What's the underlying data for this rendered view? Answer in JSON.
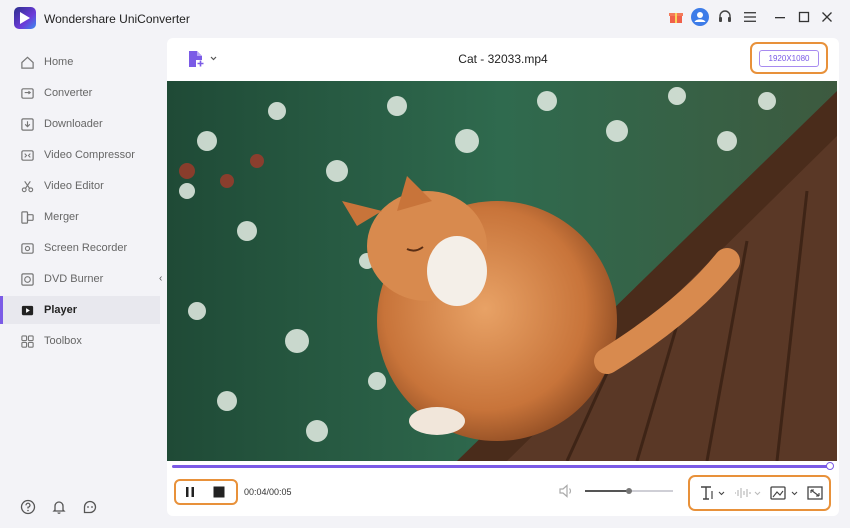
{
  "app": {
    "title": "Wondershare UniConverter"
  },
  "sidebar": {
    "items": [
      {
        "label": "Home",
        "icon": "home-icon"
      },
      {
        "label": "Converter",
        "icon": "converter-icon"
      },
      {
        "label": "Downloader",
        "icon": "download-icon"
      },
      {
        "label": "Video Compressor",
        "icon": "compress-icon"
      },
      {
        "label": "Video Editor",
        "icon": "scissors-icon"
      },
      {
        "label": "Merger",
        "icon": "merge-icon"
      },
      {
        "label": "Screen Recorder",
        "icon": "record-icon"
      },
      {
        "label": "DVD Burner",
        "icon": "disc-icon"
      },
      {
        "label": "Player",
        "icon": "play-icon",
        "active": true
      },
      {
        "label": "Toolbox",
        "icon": "grid-icon"
      }
    ]
  },
  "player": {
    "file_title": "Cat - 32033.mp4",
    "resolution": "1920X1080",
    "time": "00:04/00:05",
    "progress": 1.0,
    "volume": 0.5
  },
  "colors": {
    "accent": "#7b5be6",
    "highlight": "#e8913a"
  }
}
